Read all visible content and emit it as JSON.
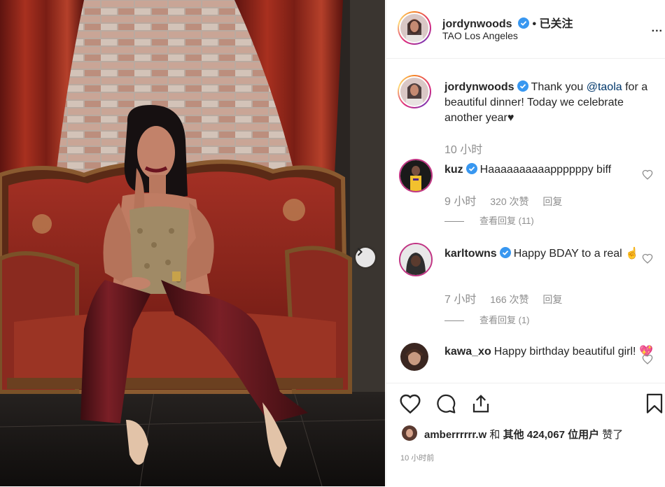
{
  "post": {
    "author": "jordynwoods",
    "follow_state": "• 已关注",
    "location": "TAO Los Angeles",
    "more_label": "...",
    "caption_user": "jordynwoods",
    "caption_pre": "Thank you ",
    "caption_mention": "@taola",
    "caption_post": " for a beautiful dinner! Today we celebrate another year♥",
    "caption_time": "10 小时"
  },
  "comments": [
    {
      "user": "kuz",
      "verified": true,
      "text": "Haaaaaaaaaappppppy biff",
      "time": "9 小时",
      "likes": "320 次赞",
      "reply": "回复",
      "view_replies": "查看回复 (11)"
    },
    {
      "user": "karltowns",
      "verified": true,
      "text": "Happy BDAY to a real ☝",
      "time": "7 小时",
      "likes": "166 次赞",
      "reply": "回复",
      "view_replies": "查看回复 (1)"
    },
    {
      "user": "kawa_xo",
      "verified": false,
      "text": "Happy birthday beautiful girl! 💖"
    }
  ],
  "likes_line": {
    "liker": "amberrrrrr.w",
    "and": " 和 ",
    "others": "其他 424,067 位用户",
    "suffix": " 赞了"
  },
  "timestamp": "10 小时前",
  "icons": [
    "verified-badge-icon",
    "heart-icon",
    "comment-icon",
    "share-icon",
    "bookmark-icon",
    "chevron-right-icon"
  ],
  "colors": {
    "link": "#00376b",
    "verified": "#3897f0",
    "meta": "#8e8e8e",
    "text": "#262626"
  }
}
